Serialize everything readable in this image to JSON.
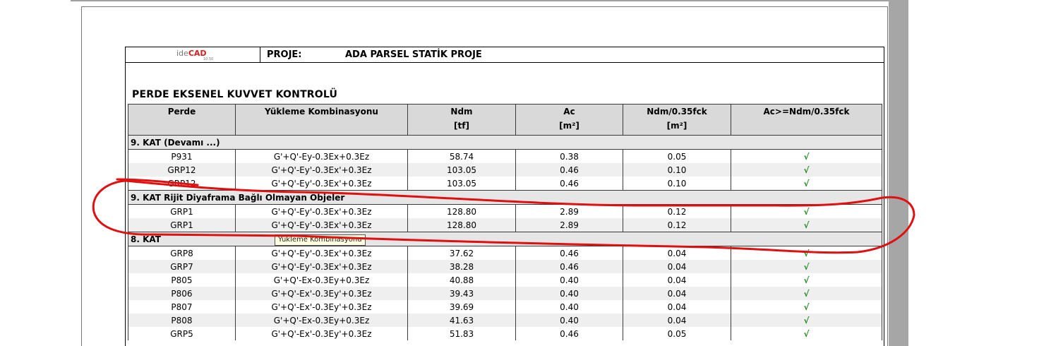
{
  "logo": {
    "ide": "ide",
    "cad": "CAD",
    "version": "10.50"
  },
  "header": {
    "proj_label": "PROJE:",
    "proj_name": "ADA  PARSEL STATİK PROJE"
  },
  "report_title": "PERDE EKSENEL KUVVET KONTROLÜ",
  "columns": [
    {
      "name": "Perde",
      "unit": ""
    },
    {
      "name": "Yükleme Kombinasyonu",
      "unit": ""
    },
    {
      "name": "Ndm",
      "unit": "[tf]"
    },
    {
      "name": "Ac",
      "unit": "[m²]"
    },
    {
      "name": "Ndm/0.35fck",
      "unit": "[m²]"
    },
    {
      "name": "Ac>=Ndm/0.35fck",
      "unit": ""
    }
  ],
  "sections": [
    {
      "title": "9. KAT   (Devamı ...)",
      "rows": [
        [
          "P931",
          "G'+Q'-Ey-0.3Ex+0.3Ez",
          "58.74",
          "0.38",
          "0.05",
          "√"
        ],
        [
          "GRP12",
          "G'+Q'-Ey'-0.3Ex'+0.3Ez",
          "103.05",
          "0.46",
          "0.10",
          "√"
        ],
        [
          "GRP12",
          "G'+Q'-Ey'-0.3Ex'+0.3Ez",
          "103.05",
          "0.46",
          "0.10",
          "√"
        ]
      ]
    },
    {
      "title": "9. KAT Rijit Diyaframa Bağlı Olmayan Objeler",
      "rows": [
        [
          "GRP1",
          "G'+Q'-Ey'-0.3Ex'+0.3Ez",
          "128.80",
          "2.89",
          "0.12",
          "√"
        ],
        [
          "GRP1",
          "G'+Q'-Ey'-0.3Ex'+0.3Ez",
          "128.80",
          "2.89",
          "0.12",
          "√"
        ]
      ]
    },
    {
      "title": "8. KAT",
      "rows": [
        [
          "GRP8",
          "G'+Q'-Ey'-0.3Ex'+0.3Ez",
          "37.62",
          "0.46",
          "0.04",
          "√"
        ],
        [
          "GRP7",
          "G'+Q'-Ey'-0.3Ex'+0.3Ez",
          "38.28",
          "0.46",
          "0.04",
          "√"
        ],
        [
          "P805",
          "G'+Q'-Ex-0.3Ey+0.3Ez",
          "40.88",
          "0.40",
          "0.04",
          "√"
        ],
        [
          "P806",
          "G'+Q'-Ex'-0.3Ey'+0.3Ez",
          "39.43",
          "0.40",
          "0.04",
          "√"
        ],
        [
          "P807",
          "G'+Q'-Ex'-0.3Ey'+0.3Ez",
          "39.69",
          "0.40",
          "0.04",
          "√"
        ],
        [
          "P808",
          "G'+Q'-Ex-0.3Ey+0.3Ez",
          "41.63",
          "0.40",
          "0.04",
          "√"
        ],
        [
          "GRP5",
          "G'+Q'-Ex'-0.3Ey'+0.3Ez",
          "51.83",
          "0.46",
          "0.05",
          "√"
        ]
      ]
    }
  ],
  "tooltip": "Yükleme Kombinasyonu",
  "colors": {
    "annotation": "#e01010",
    "check": "#1a8a1a",
    "header_bg": "#d9d9d9"
  }
}
